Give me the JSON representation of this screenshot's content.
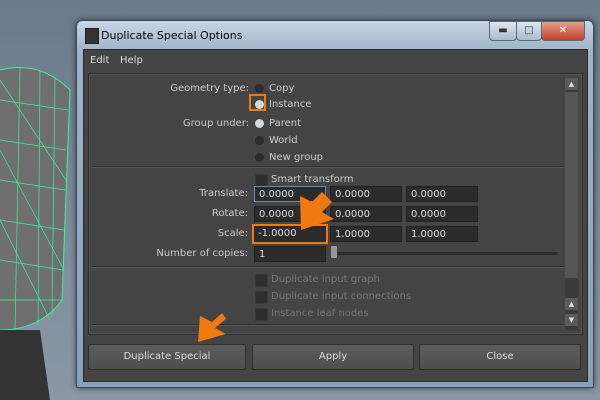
{
  "window": {
    "title": "Duplicate Special Options",
    "minimize": "▬",
    "maximize": "□",
    "close": "✕"
  },
  "menu": [
    "Edit",
    "Help"
  ],
  "geometry_type": {
    "label": "Geometry type:",
    "options": [
      "Copy",
      "Instance"
    ],
    "selected": "Instance"
  },
  "group_under": {
    "label": "Group under:",
    "options": [
      "Parent",
      "World",
      "New group"
    ],
    "selected": "Parent"
  },
  "smart_transform": {
    "label": "Smart transform",
    "checked": false
  },
  "translate": {
    "label": "Translate:",
    "values": [
      "0.0000",
      "0.0000",
      "0.0000"
    ]
  },
  "rotate": {
    "label": "Rotate:",
    "values": [
      "0.0000",
      "0.0000",
      "0.0000"
    ]
  },
  "scale": {
    "label": "Scale:",
    "values": [
      "-1.0000",
      "1.0000",
      "1.0000"
    ]
  },
  "copies": {
    "label": "Number of copies:",
    "value": "1"
  },
  "disabled_options": [
    "Duplicate input graph",
    "Duplicate input connections",
    "Instance leaf nodes"
  ],
  "buttons": {
    "duplicate": "Duplicate Special",
    "apply": "Apply",
    "close": "Close"
  },
  "colors": {
    "highlight": "#f07a10",
    "wireframe": "#3cf0a0"
  }
}
